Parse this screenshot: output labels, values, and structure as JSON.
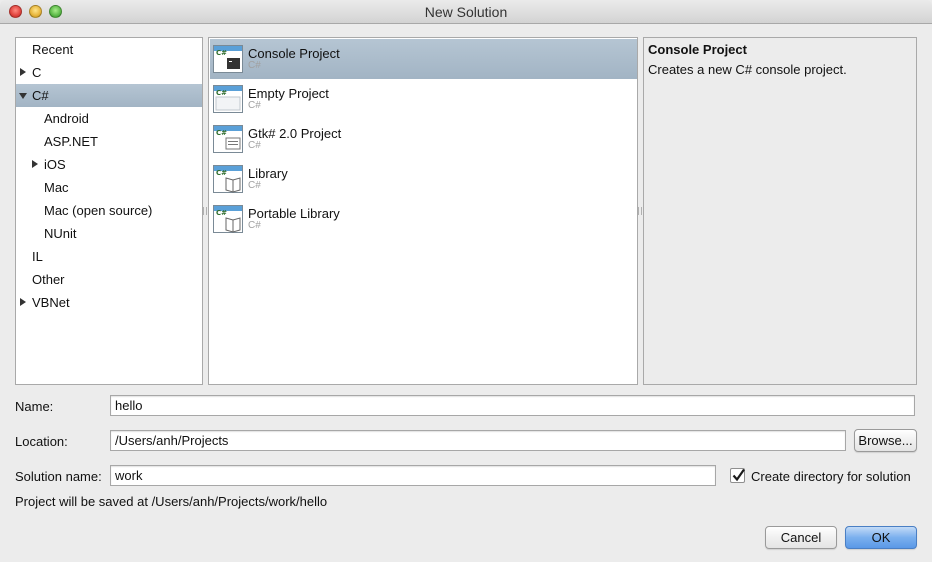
{
  "window": {
    "title": "New Solution"
  },
  "categories": {
    "items": [
      {
        "label": "Recent"
      },
      {
        "label": "C"
      },
      {
        "label": "C#"
      },
      {
        "label": "Android"
      },
      {
        "label": "ASP.NET"
      },
      {
        "label": "iOS"
      },
      {
        "label": "Mac"
      },
      {
        "label": "Mac (open source)"
      },
      {
        "label": "NUnit"
      },
      {
        "label": "IL"
      },
      {
        "label": "Other"
      },
      {
        "label": "VBNet"
      }
    ],
    "selected": "C#"
  },
  "templates": {
    "items": [
      {
        "name": "Console Project",
        "lang": "C#",
        "icon": "console-project-icon"
      },
      {
        "name": "Empty Project",
        "lang": "C#",
        "icon": "empty-project-icon"
      },
      {
        "name": "Gtk# 2.0 Project",
        "lang": "C#",
        "icon": "gtk-project-icon"
      },
      {
        "name": "Library",
        "lang": "C#",
        "icon": "library-project-icon"
      },
      {
        "name": "Portable Library",
        "lang": "C#",
        "icon": "portable-library-icon"
      }
    ],
    "selected": "Console Project"
  },
  "description": {
    "title": "Console Project",
    "text": "Creates a new C# console project."
  },
  "form": {
    "name_label": "Name:",
    "name_value": "hello",
    "location_label": "Location:",
    "location_value": "/Users/anh/Projects",
    "browse_label": "Browse...",
    "solution_label": "Solution name:",
    "solution_value": "work",
    "create_dir_label": "Create directory for solution",
    "create_dir_checked": true,
    "saved_at": "Project will be saved at /Users/anh/Projects/work/hello"
  },
  "buttons": {
    "cancel": "Cancel",
    "ok": "OK"
  },
  "colors": {
    "selection": "#a9bacb",
    "primary_button": "#6aa5ec"
  }
}
